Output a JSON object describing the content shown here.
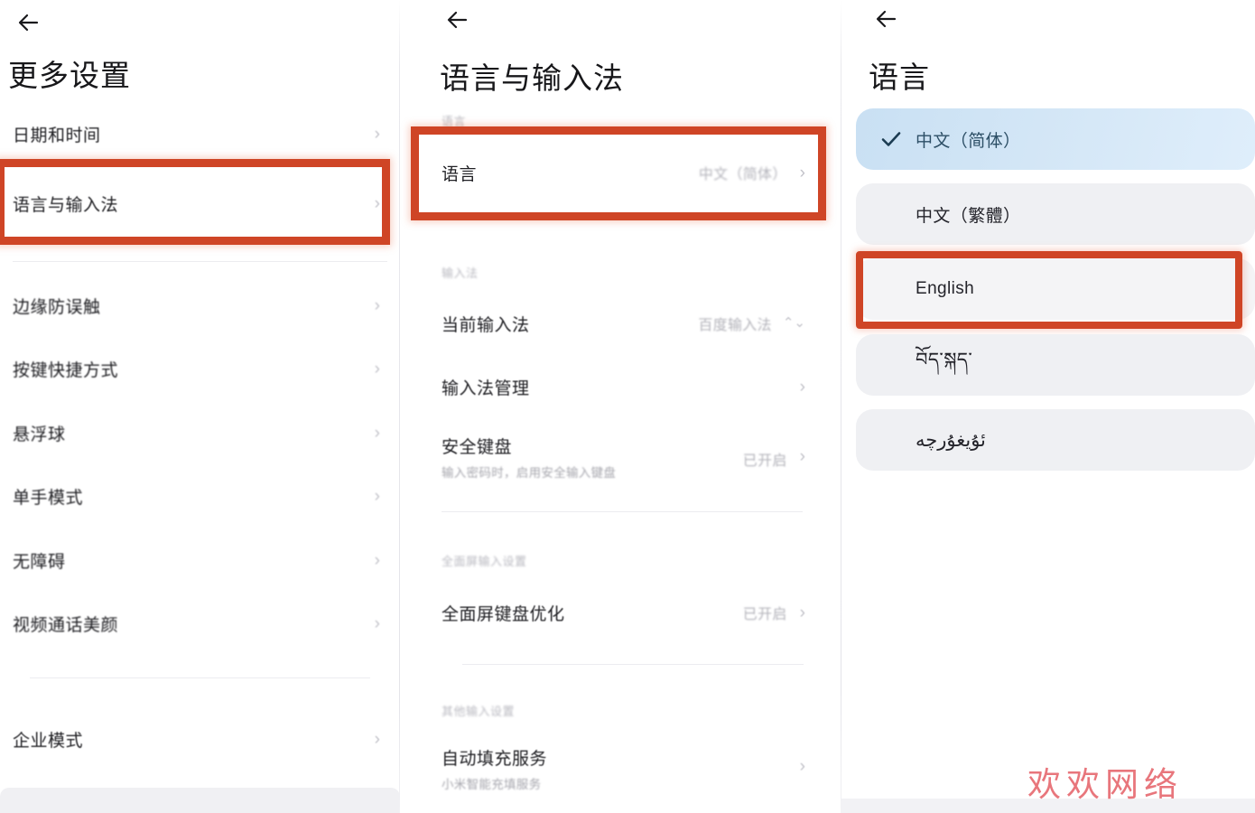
{
  "left_screen": {
    "back_icon": "back-arrow-icon",
    "title": "更多设置",
    "items": [
      {
        "label": "日期和时间",
        "chevron": "›"
      },
      {
        "label": "语言与输入法",
        "chevron": "›"
      },
      {
        "label": "边缘防误触",
        "chevron": "›"
      },
      {
        "label": "按键快捷方式",
        "chevron": "›"
      },
      {
        "label": "悬浮球",
        "chevron": "›"
      },
      {
        "label": "单手模式",
        "chevron": "›"
      },
      {
        "label": "无障碍",
        "chevron": "›"
      },
      {
        "label": "视频通话美颜",
        "chevron": "›"
      },
      {
        "label": "企业模式",
        "chevron": "›"
      }
    ]
  },
  "middle_screen": {
    "back_icon": "back-arrow-icon",
    "title": "语言与输入法",
    "sections": [
      {
        "label": "语言",
        "rows": [
          {
            "label": "语言",
            "value": "中文（简体）",
            "chevron": "›"
          }
        ]
      },
      {
        "label": "输入法",
        "rows": [
          {
            "label": "当前输入法",
            "value": "百度输入法",
            "chevron": "⌃⌄"
          },
          {
            "label": "输入法管理",
            "value": "",
            "chevron": "›"
          },
          {
            "label": "安全键盘",
            "sub": "输入密码时，启用安全输入键盘",
            "value": "已开启",
            "chevron": "›"
          }
        ]
      },
      {
        "label": "全面屏输入设置",
        "rows": [
          {
            "label": "全面屏键盘优化",
            "value": "已开启",
            "chevron": "›"
          }
        ]
      },
      {
        "label": "其他输入设置",
        "rows": [
          {
            "label": "自动填充服务",
            "sub": "小米智能充填服务",
            "value": "",
            "chevron": "›"
          }
        ]
      }
    ]
  },
  "right_screen": {
    "back_icon": "back-arrow-icon",
    "title": "语言",
    "languages": [
      {
        "label": "中文（简体）",
        "selected": true,
        "check_icon": "check-icon"
      },
      {
        "label": "中文（繁體）",
        "selected": false
      },
      {
        "label": "English",
        "selected": false
      },
      {
        "label": "བོད་སྐད་",
        "selected": false
      },
      {
        "label": "ئۇيغۇرچە",
        "selected": false
      }
    ]
  },
  "annotations": {
    "highlight_color": "#cf4526",
    "boxes": [
      {
        "target": "语言与输入法"
      },
      {
        "target": "语言"
      },
      {
        "target": "English"
      }
    ]
  },
  "watermark": {
    "text": "欢欢网络",
    "color": "#e8767c"
  }
}
